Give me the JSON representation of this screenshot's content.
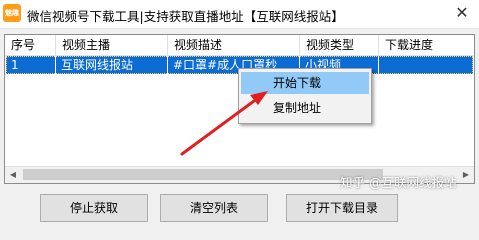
{
  "window": {
    "app_icon_text": "魅趣",
    "title": "微信视频号下载工具|支持获取直播地址【互联网线报站】",
    "close_glyph": "✕"
  },
  "table": {
    "columns": [
      "序号",
      "视频主播",
      "视频描述",
      "视频类型",
      "下载进度"
    ],
    "rows": [
      [
        "1",
        "互联网线报站",
        "#口罩#成人口罩秒",
        "小视频",
        ""
      ]
    ],
    "selection_color": "#0c6cd4"
  },
  "context_menu": {
    "items": [
      "开始下载",
      "复制地址"
    ]
  },
  "buttons": {
    "stop": "停止获取",
    "clear": "清空列表",
    "open_dir": "打开下载目录"
  },
  "watermark": "知乎 @互联网线报站",
  "colors": {
    "accent": "#0c6cd4",
    "annotation_arrow": "#e02020",
    "app_icon": "#ff9c1a"
  }
}
